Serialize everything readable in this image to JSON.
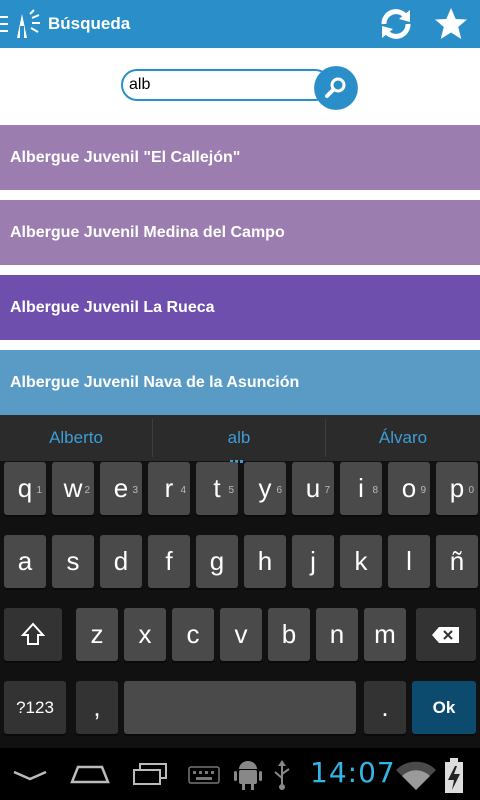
{
  "app": {
    "title": "Búsqueda"
  },
  "colors": {
    "brand": "#2a8fc9",
    "result_colors": [
      "#9b7db0",
      "#9b7db0",
      "#6e4fae",
      "#5a9bc6"
    ]
  },
  "icons": {
    "menu": "menu-icon",
    "logo": "app-logo",
    "sync": "sync-icon",
    "favorites": "star-icon",
    "search": "search-icon"
  },
  "search": {
    "value": "alb"
  },
  "results": [
    {
      "label": "Albergue Juvenil \"El Callejón\""
    },
    {
      "label": "Albergue Juvenil Medina del Campo"
    },
    {
      "label": "Albergue Juvenil La Rueca"
    },
    {
      "label": "Albergue Juvenil Nava de la Asunción"
    }
  ],
  "keyboard": {
    "suggestions": [
      "Alberto",
      "alb",
      "Álvaro"
    ],
    "row1": [
      {
        "k": "q",
        "h": "1"
      },
      {
        "k": "w",
        "h": "2"
      },
      {
        "k": "e",
        "h": "3"
      },
      {
        "k": "r",
        "h": "4"
      },
      {
        "k": "t",
        "h": "5"
      },
      {
        "k": "y",
        "h": "6"
      },
      {
        "k": "u",
        "h": "7"
      },
      {
        "k": "i",
        "h": "8"
      },
      {
        "k": "o",
        "h": "9"
      },
      {
        "k": "p",
        "h": "0"
      }
    ],
    "row2": [
      "a",
      "s",
      "d",
      "f",
      "g",
      "h",
      "j",
      "k",
      "l",
      "ñ"
    ],
    "row3": [
      "z",
      "x",
      "c",
      "v",
      "b",
      "n",
      "m"
    ],
    "symbols_label": "?123",
    "comma": ",",
    "period": ".",
    "ok_label": "Ok"
  },
  "status": {
    "time": "14:07"
  }
}
